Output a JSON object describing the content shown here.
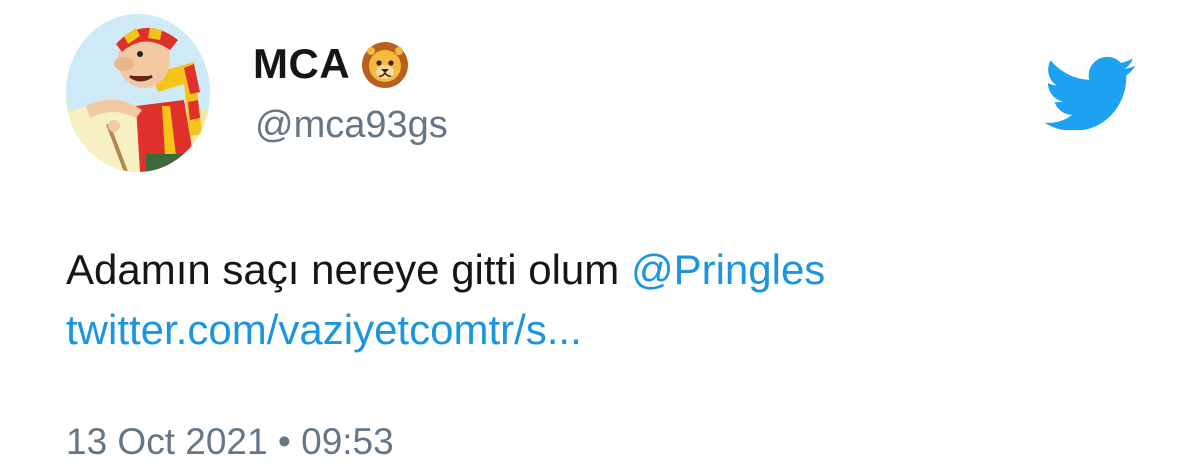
{
  "user": {
    "display_name": "MCA",
    "handle": "@mca93gs",
    "avatar_icon": "cartoon-avatar",
    "name_emoji_icon": "lion-face-icon"
  },
  "tweet": {
    "text_before_mention": "Adamın saçı nereye gitti olum ",
    "mention": "@Pringles",
    "link": "twitter.com/vaziyetcomtr/s..."
  },
  "meta": {
    "date": "13 Oct 2021",
    "separator": "•",
    "time": "09:53"
  },
  "brand": {
    "logo_icon": "twitter-bird-icon",
    "accent_color": "#1da1f2",
    "link_color": "#1b95e0",
    "secondary_text_color": "#657786"
  }
}
